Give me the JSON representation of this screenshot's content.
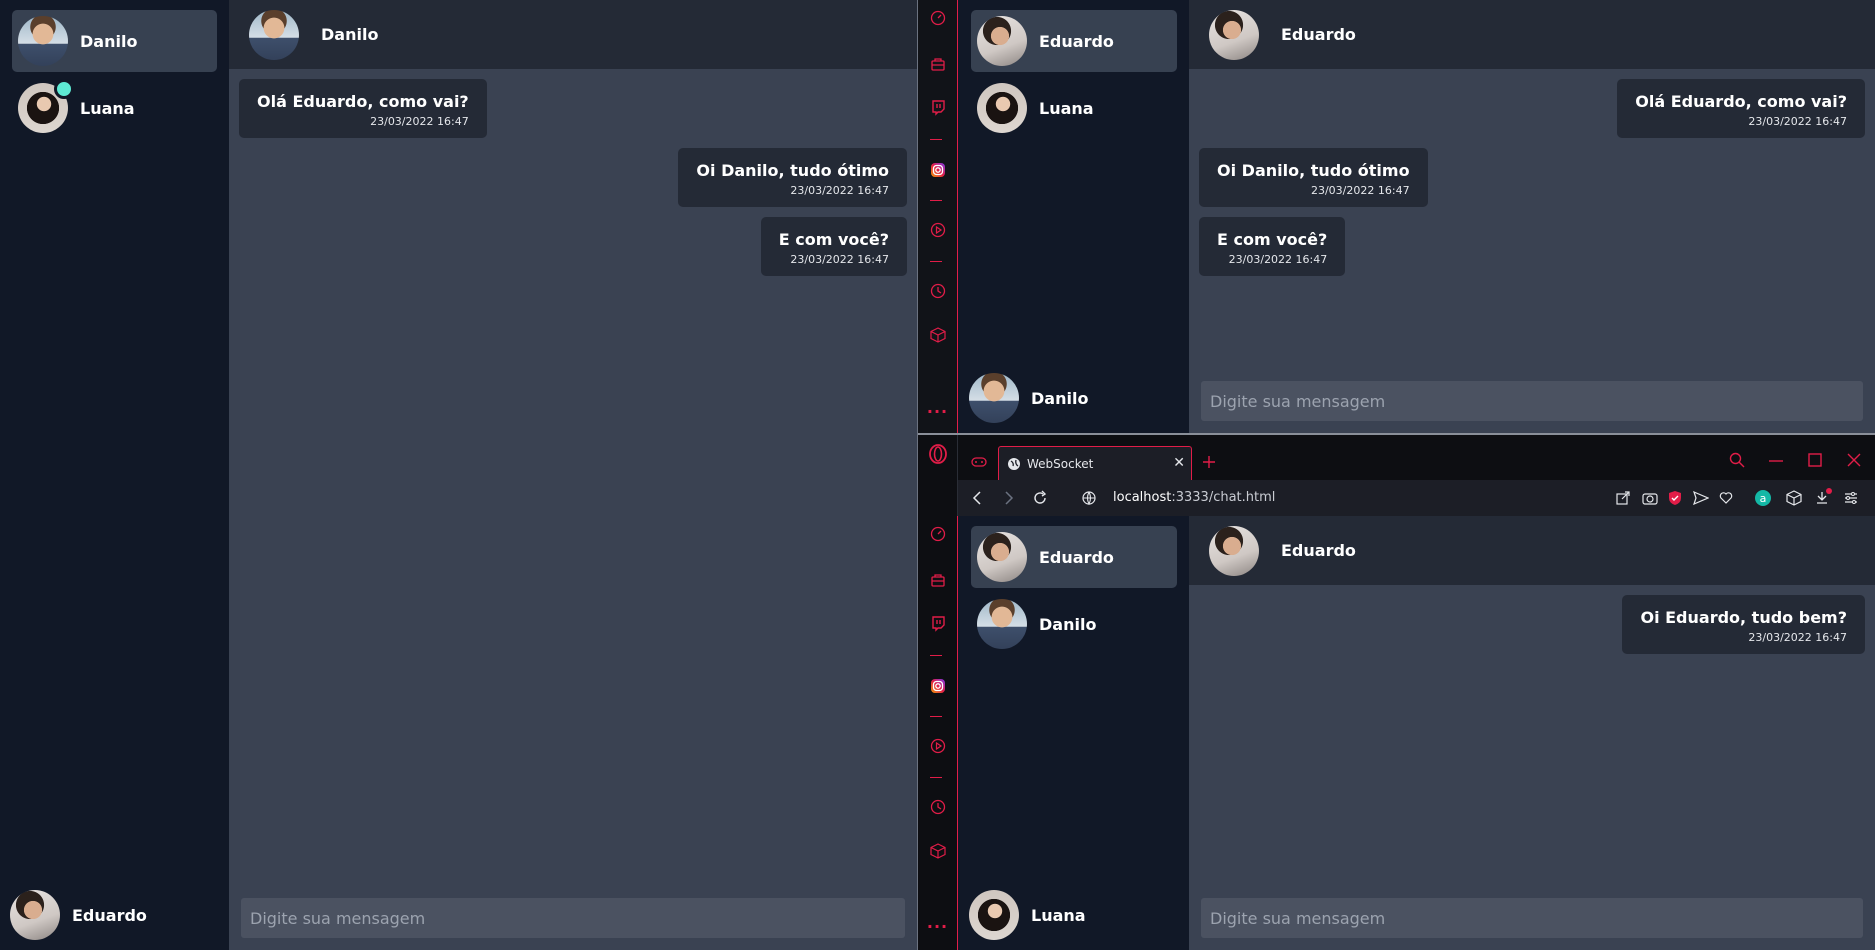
{
  "left_window": {
    "contacts": [
      {
        "name": "Danilo",
        "avatar": "danilo",
        "active": true,
        "online": false
      },
      {
        "name": "Luana",
        "avatar": "luana",
        "active": false,
        "online": true
      }
    ],
    "current_user": {
      "name": "Eduardo",
      "avatar": "eduardo"
    },
    "header": {
      "name": "Danilo",
      "avatar": "danilo"
    },
    "messages": [
      {
        "text": "Olá Eduardo, como vai?",
        "time": "23/03/2022 16:47",
        "side": "left"
      },
      {
        "text": "Oi Danilo, tudo ótimo",
        "time": "23/03/2022 16:47",
        "side": "right"
      },
      {
        "text": "E com você?",
        "time": "23/03/2022 16:47",
        "side": "right"
      }
    ],
    "input_placeholder": "Digite sua mensagem"
  },
  "top_right_window": {
    "contacts": [
      {
        "name": "Eduardo",
        "avatar": "eduardo",
        "active": true,
        "online": false
      },
      {
        "name": "Luana",
        "avatar": "luana",
        "active": false,
        "online": false
      }
    ],
    "current_user": {
      "name": "Danilo",
      "avatar": "danilo"
    },
    "header": {
      "name": "Eduardo",
      "avatar": "eduardo"
    },
    "messages": [
      {
        "text": "Olá Eduardo, como vai?",
        "time": "23/03/2022 16:47",
        "side": "right"
      },
      {
        "text": "Oi Danilo, tudo ótimo",
        "time": "23/03/2022 16:47",
        "side": "left"
      },
      {
        "text": "E com você?",
        "time": "23/03/2022 16:47",
        "side": "left"
      }
    ],
    "input_placeholder": "Digite sua mensagem"
  },
  "bottom_right_window": {
    "tab_title": "WebSocket",
    "url_host": "localhost",
    "url_path": ":3333/chat.html",
    "contacts": [
      {
        "name": "Eduardo",
        "avatar": "eduardo",
        "active": true,
        "online": false
      },
      {
        "name": "Danilo",
        "avatar": "danilo",
        "active": false,
        "online": false
      }
    ],
    "current_user": {
      "name": "Luana",
      "avatar": "luana"
    },
    "header": {
      "name": "Eduardo",
      "avatar": "eduardo"
    },
    "messages": [
      {
        "text": "Oi Eduardo, tudo bem?",
        "time": "23/03/2022 16:47",
        "side": "right"
      }
    ],
    "input_placeholder": "Digite sua mensagem"
  },
  "opera_sidebar_icons": [
    "speed-dial-icon",
    "shopping-icon",
    "twitch-icon",
    "instagram-icon",
    "player-icon",
    "history-icon",
    "extensions-icon",
    "more-icon"
  ],
  "colors": {
    "sidebar_bg": "#111827",
    "conv_bg": "#3a4252",
    "bubble_bg": "#242a36",
    "active_contact": "#374151",
    "online": "#5eead4",
    "opera_red": "#e11d48"
  }
}
